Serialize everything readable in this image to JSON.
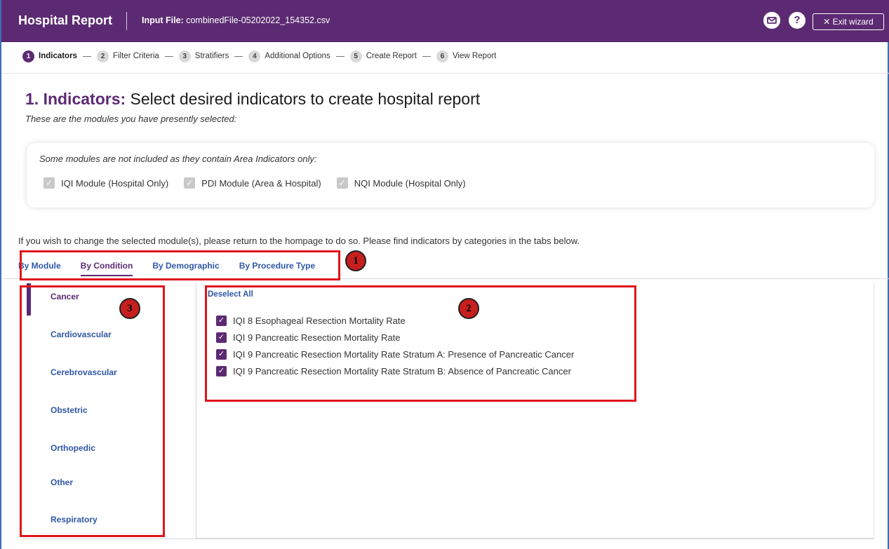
{
  "header": {
    "title": "Hospital Report",
    "input_label": "Input File:",
    "input_value": "combinedFile-05202022_154352.csv",
    "mail_icon": "mail-icon",
    "help_icon": "help-icon",
    "help_glyph": "?",
    "exit_label": "✕  Exit wizard"
  },
  "stepper": [
    {
      "num": "1",
      "label": "Indicators"
    },
    {
      "num": "2",
      "label": "Filter Criteria"
    },
    {
      "num": "3",
      "label": "Stratifiers"
    },
    {
      "num": "4",
      "label": "Additional Options"
    },
    {
      "num": "5",
      "label": "Create Report"
    },
    {
      "num": "6",
      "label": "View Report"
    }
  ],
  "heading": {
    "prefix": "1. Indicators:",
    "text": " Select desired indicators to create hospital report",
    "subtitle": "These are the modules you have presently selected:"
  },
  "modules": {
    "note": "Some modules are not included as they contain Area Indicators only:",
    "items": [
      "IQI Module (Hospital Only)",
      "PDI Module (Area & Hospital)",
      "NQI Module (Hospital Only)"
    ]
  },
  "info": "If you wish to change the selected module(s), please return to the hompage to do so. Please find indicators by categories in the tabs below.",
  "tabs": [
    "By Module",
    "By Condition",
    "By Demographic",
    "By Procedure Type"
  ],
  "categories": [
    "Cancer",
    "Cardiovascular",
    "Cerebrovascular",
    "Obstetric",
    "Orthopedic",
    "Other",
    "Respiratory"
  ],
  "deselect_label": "Deselect All",
  "indicators": [
    "IQI 8 Esophageal Resection Mortality Rate",
    "IQI 9 Pancreatic Resection Mortality Rate",
    "IQI 9 Pancreatic Resection Mortality Rate Stratum A: Presence of Pancreatic Cancer",
    "IQI 9 Pancreatic Resection Mortality Rate Stratum B: Absence of Pancreatic Cancer"
  ],
  "annotations": {
    "tabs": "1",
    "indicators": "2",
    "categories": "3"
  },
  "colors": {
    "brand": "#5c2a72",
    "link": "#2f57a6",
    "annotation": "#e0141b"
  }
}
